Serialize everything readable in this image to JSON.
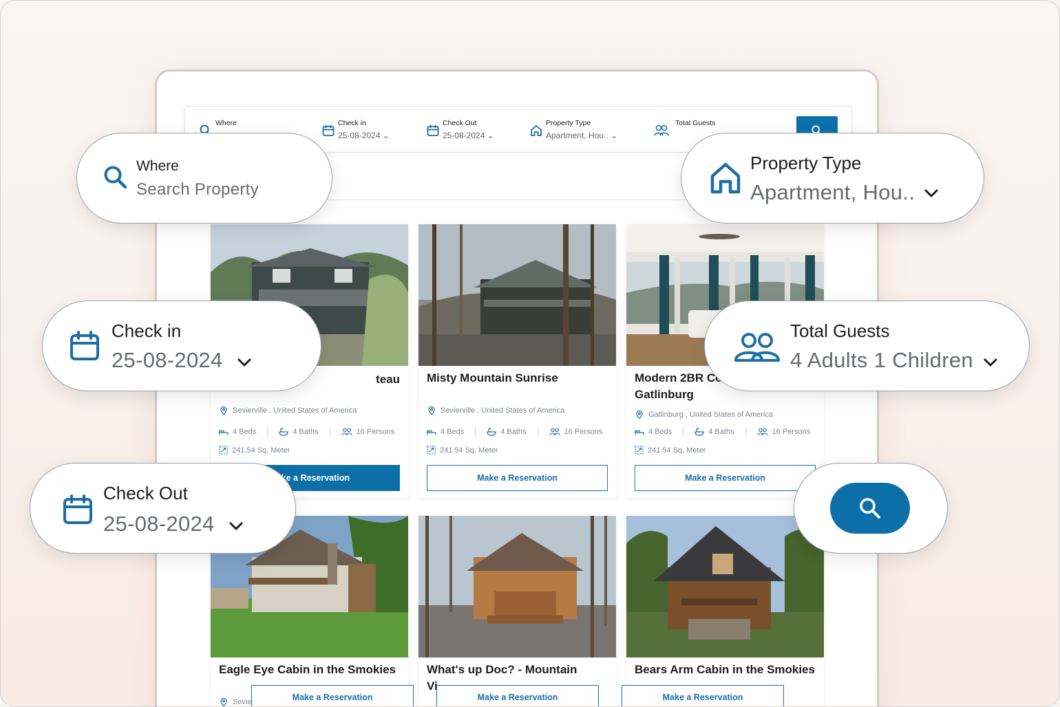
{
  "search_bar": {
    "where": {
      "label": "Where",
      "value": "Search Property",
      "icon": "search-icon"
    },
    "check_in": {
      "label": "Check in",
      "value": "25-08-2024",
      "icon": "calendar-icon"
    },
    "check_out": {
      "label": "Check Out",
      "value": "25-08-2024",
      "icon": "calendar-icon"
    },
    "property_type": {
      "label": "Property Type",
      "value": "Apartment, Hou..",
      "icon": "house-icon"
    },
    "total_guests": {
      "label": "Total Guests",
      "value": "4 Adults   1 Children",
      "icon": "users-icon"
    }
  },
  "cards": [
    {
      "title": "Cozy Chateau",
      "title_visible": "teau",
      "location": "Sevierville , United States of America",
      "beds": "4 Beds",
      "baths": "4 Baths",
      "persons": "16 Persons",
      "area": "241.54 Sq. Meter",
      "button": "Make a Reservation",
      "button_visible": "ke a Reservation"
    },
    {
      "title": "Misty Mountain Sunrise",
      "location": "Sevierville , United States of America",
      "beds": "4 Beds",
      "baths": "4 Baths",
      "persons": "16 Persons",
      "area": "241.54 Sq. Meter",
      "button": "Make a Reservation"
    },
    {
      "title_line1": "Modern 2BR Co",
      "title_line2": "Gatlinburg",
      "location": "Gatlinburg , United States of America",
      "beds": "4 Beds",
      "baths": "4 Baths",
      "persons": "16 Persons",
      "area": "241.54 Sq. Meter",
      "button": "Make a Reservation"
    },
    {
      "title": "Eagle Eye Cabin in the Smokies",
      "location": "Sevie",
      "button": "Make a Reservation"
    },
    {
      "title_line1": "What's up Doc? - Mountain",
      "title_line2": "Vi",
      "button": "Make a Reservation"
    },
    {
      "title": "Bears Arm Cabin in the Smokies",
      "button": "Make a Reservation"
    }
  ],
  "pills": {
    "where": {
      "label": "Where",
      "value": "Search Property"
    },
    "check_in": {
      "label": "Check in",
      "value": "25-08-2024"
    },
    "check_out": {
      "label": "Check Out",
      "value": "25-08-2024"
    },
    "property_type": {
      "label": "Property Type",
      "value": "Apartment, Hou.."
    },
    "total_guests": {
      "label": "Total Guests",
      "value": "4 Adults  1 Children"
    }
  },
  "colors": {
    "brand": "#0d6fa8",
    "accent_bg": "#fbd9c6"
  }
}
